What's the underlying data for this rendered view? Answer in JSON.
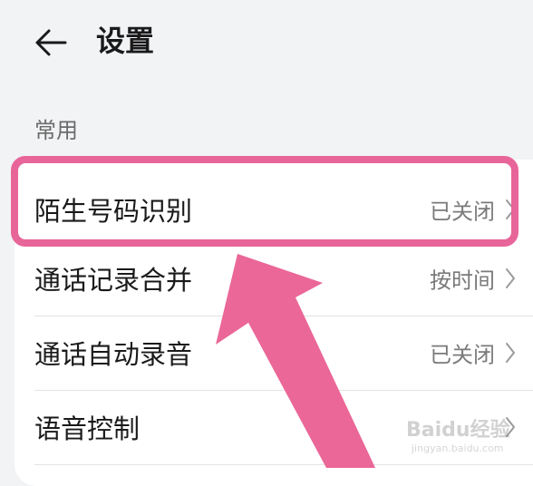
{
  "header": {
    "title": "设置",
    "back_icon": "arrow-left-icon"
  },
  "section": {
    "label": "常用"
  },
  "settings": [
    {
      "label": "陌生号码识别",
      "value": "已关闭",
      "highlighted": true
    },
    {
      "label": "通话记录合并",
      "value": "按时间"
    },
    {
      "label": "通话自动录音",
      "value": "已关闭"
    },
    {
      "label": "语音控制",
      "value": ""
    }
  ],
  "annotation": {
    "highlight_color": "#e8659a",
    "arrow_color": "#ea6797"
  },
  "watermark": {
    "logo": "Baidu经验",
    "domain": "jingyan.baidu.com"
  },
  "colors": {
    "background": "#f1f3f5",
    "card": "#ffffff",
    "text_primary": "#1a1a1a",
    "text_secondary": "#7a7a7a"
  }
}
